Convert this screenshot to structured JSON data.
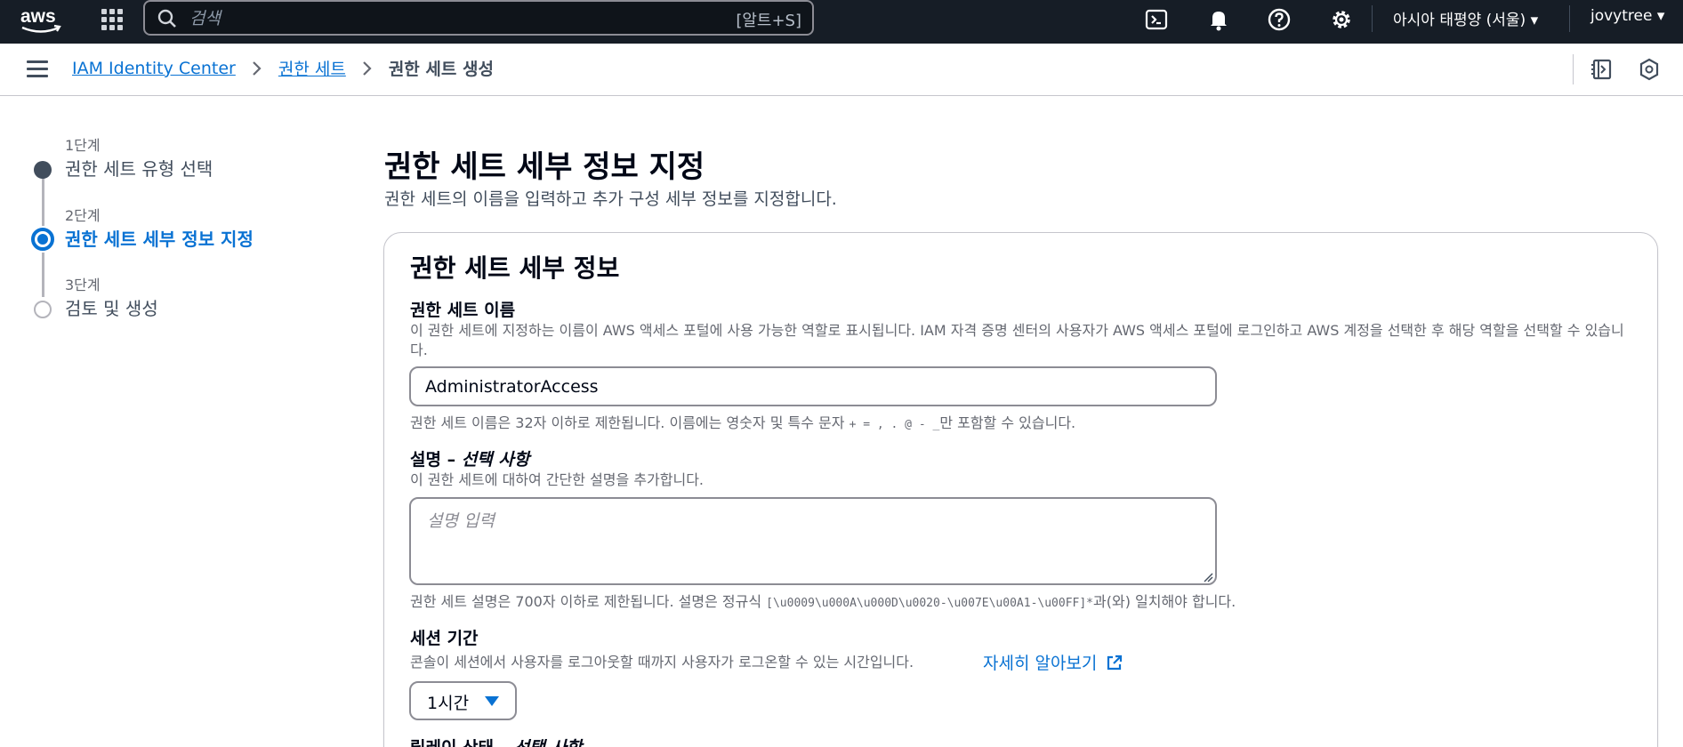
{
  "topnav": {
    "logo_text": "aws",
    "search_placeholder": "검색",
    "search_shortcut": "[알트+S]",
    "region": "아시아 태평양 (서울) ▾",
    "user": "jovytree ▾",
    "icons": [
      "cloudshell-icon",
      "bell-icon",
      "help-icon",
      "gear-icon"
    ]
  },
  "breadcrumb": {
    "items": [
      {
        "label": "IAM Identity Center"
      },
      {
        "label": "권한 세트"
      }
    ],
    "current": "권한 세트 생성"
  },
  "steps": [
    {
      "number": "1단계",
      "title": "권한 세트 유형 선택",
      "state": "completed"
    },
    {
      "number": "2단계",
      "title": "권한 세트 세부 정보 지정",
      "state": "active"
    },
    {
      "number": "3단계",
      "title": "검토 및 생성",
      "state": "pending"
    }
  ],
  "page": {
    "title": "권한 세트 세부 정보 지정",
    "description": "권한 세트의 이름을 입력하고 추가 구성 세부 정보를 지정합니다."
  },
  "details": {
    "section_title": "권한 세트 세부 정보",
    "name": {
      "label": "권한 세트 이름",
      "description": "이 권한 세트에 지정하는 이름이 AWS 액세스 포털에 사용 가능한 역할로 표시됩니다. IAM 자격 증명 센터의 사용자가 AWS 액세스 포털에 로그인하고 AWS 계정을 선택한 후 해당 역할을 선택할 수 있습니다.",
      "value": "AdministratorAccess",
      "constraint_prefix": "권한 세트 이름은 32자 이하로 제한됩니다. 이름에는 영숫자 및 특수 문자 ",
      "constraint_chars": "+ = , . @ - _",
      "constraint_suffix": "만 포함할 수 있습니다."
    },
    "description_field": {
      "label": "설명 – ",
      "label_optional": "선택 사항",
      "hint": "이 권한 세트에 대하여 간단한 설명을 추가합니다.",
      "placeholder": "설명 입력",
      "constraint_prefix": "권한 세트 설명은 700자 이하로 제한됩니다. 설명은 정규식 ",
      "constraint_regex": "[\\u0009\\u000A\\u000D\\u0020-\\u007E\\u00A1-\\u00FF]*",
      "constraint_suffix": "과(와) 일치해야 합니다."
    },
    "session": {
      "label": "세션 기간",
      "description": "콘솔이 세션에서 사용자를 로그아웃할 때까지 사용자가 로그온할 수 있는 시간입니다.",
      "learn_more": "자세히 알아보기",
      "selected": "1시간"
    },
    "relay": {
      "label": "릴레이 상태 – ",
      "label_optional": "선택 사항"
    }
  },
  "colors": {
    "nav_bg": "#161d26",
    "link": "#0972d3",
    "text": "#000716",
    "muted": "#656871"
  }
}
